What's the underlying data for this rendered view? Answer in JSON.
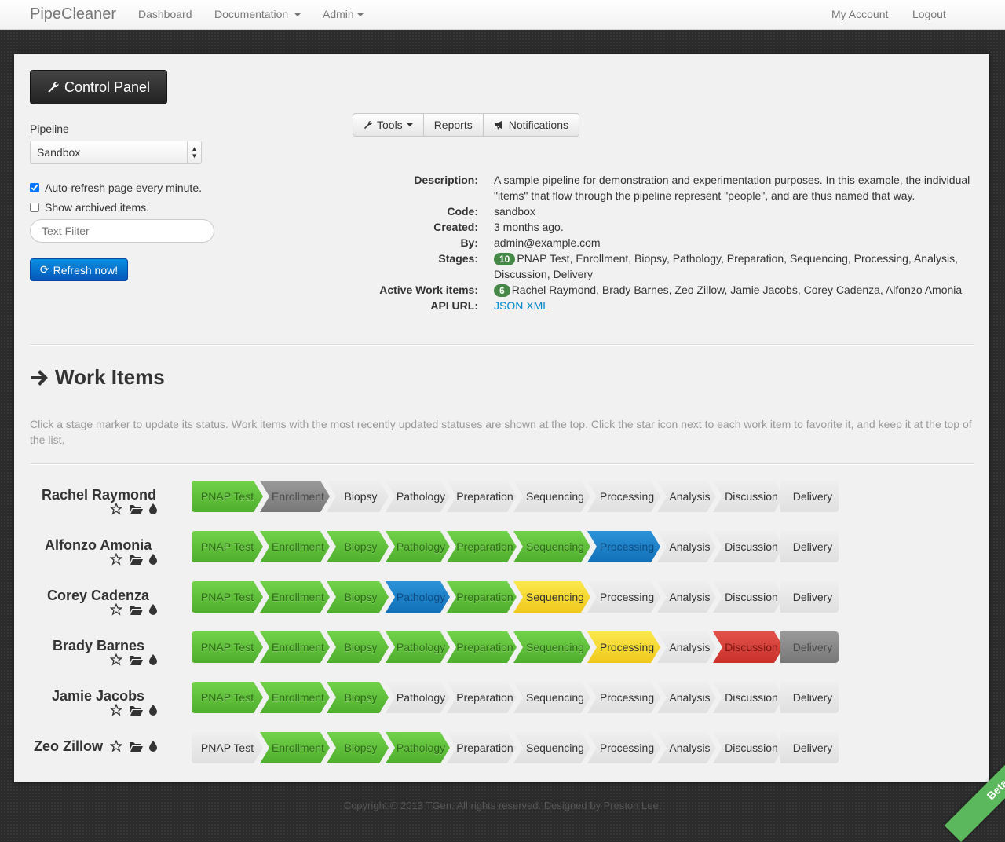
{
  "navbar": {
    "brand": "PipeCleaner",
    "items": [
      "Dashboard",
      "Documentation",
      "Admin"
    ],
    "right": [
      "My Account",
      "Logout"
    ]
  },
  "control_panel": {
    "title": "Control Panel",
    "pipeline_label": "Pipeline",
    "pipeline_value": "Sandbox",
    "auto_refresh_label": "Auto-refresh page every minute.",
    "auto_refresh_checked": true,
    "show_archived_label": "Show archived items.",
    "show_archived_checked": false,
    "filter_placeholder": "Text Filter",
    "refresh_label": "Refresh now!"
  },
  "toolbar": {
    "tools": "Tools",
    "reports": "Reports",
    "notifications": "Notifications"
  },
  "details": {
    "description_key": "Description:",
    "description": "A sample pipeline for demonstration and experimentation purposes. In this example, the individual \"items\" that flow through the pipeline represent \"people\", and are thus named that way.",
    "code_key": "Code:",
    "code": "sandbox",
    "created_key": "Created:",
    "created": "3 months ago.",
    "by_key": "By:",
    "by": "admin@example.com",
    "stages_key": "Stages:",
    "stages_count": "10",
    "stages": "PNAP Test, Enrollment, Biopsy, Pathology, Preparation, Sequencing, Processing, Analysis, Discussion, Delivery",
    "active_key": "Active Work items:",
    "active_count": "6",
    "active": "Rachel Raymond, Brady Barnes, Zeo Zillow, Jamie Jacobs, Corey Cadenza, Alfonzo Amonia",
    "api_key": "API URL:",
    "api_json": "JSON",
    "api_xml": "XML"
  },
  "work_items_section": {
    "title": "Work Items",
    "help": "Click a stage marker to update its status. Work items with the most recently updated statuses are shown at the top. Click the star icon next to each work item to favorite it, and keep it at the top of the list."
  },
  "stage_names": [
    "PNAP Test",
    "Enrollment",
    "Biopsy",
    "Pathology",
    "Preparation",
    "Sequencing",
    "Processing",
    "Analysis",
    "Discussion",
    "Delivery"
  ],
  "work_items": [
    {
      "name": "Rachel Raymond",
      "statuses": [
        "green",
        "grey",
        "none",
        "none",
        "none",
        "none",
        "none",
        "none",
        "none",
        "none"
      ]
    },
    {
      "name": "Alfonzo Amonia",
      "statuses": [
        "green",
        "green",
        "green",
        "green",
        "green",
        "green",
        "blue",
        "none",
        "none",
        "none"
      ]
    },
    {
      "name": "Corey Cadenza",
      "statuses": [
        "green",
        "green",
        "green",
        "blue",
        "green",
        "yellow",
        "none",
        "none",
        "none",
        "none"
      ]
    },
    {
      "name": "Brady Barnes",
      "statuses": [
        "green",
        "green",
        "green",
        "green",
        "green",
        "green",
        "yellow",
        "none",
        "red",
        "grey"
      ]
    },
    {
      "name": "Jamie Jacobs",
      "statuses": [
        "green",
        "green",
        "green",
        "none",
        "none",
        "none",
        "none",
        "none",
        "none",
        "none"
      ]
    },
    {
      "name": "Zeo Zillow",
      "statuses": [
        "none",
        "green",
        "green",
        "green",
        "none",
        "none",
        "none",
        "none",
        "none",
        "none"
      ]
    }
  ],
  "footer": "Copyright © 2013 TGen. All rights reserved. Designed by Preston Lee.",
  "ribbon": "Beta",
  "colors": {
    "green": "#5cbf3a",
    "grey": "#888888",
    "blue": "#1a80c8",
    "yellow": "#f5d630",
    "red": "#d6403a"
  }
}
